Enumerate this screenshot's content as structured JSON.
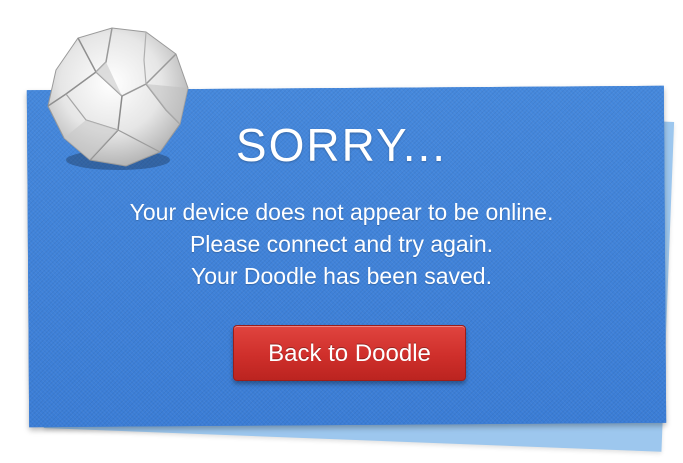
{
  "dialog": {
    "title": "SORRY...",
    "message_lines": [
      "Your device does not appear to be online.",
      "Please connect and try again.",
      "Your Doodle has been saved."
    ],
    "button_label": "Back to Doodle",
    "decoration_icon": "crumpled-paper-icon"
  },
  "colors": {
    "card_blue": "#3f82d9",
    "card_back_blue": "#9dc7ee",
    "button_red": "#cf2f2b",
    "text": "#ffffff"
  }
}
